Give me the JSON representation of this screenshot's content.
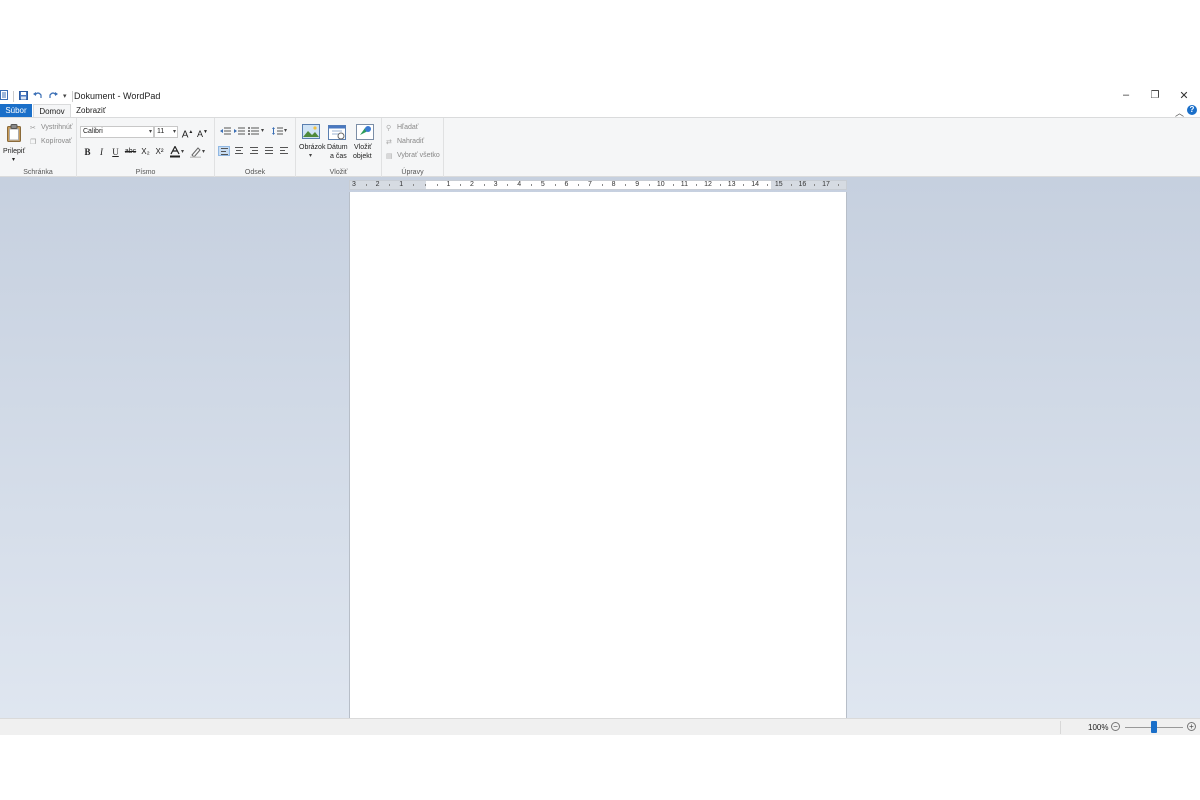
{
  "window": {
    "title": "Dokument - WordPad",
    "controls": {
      "minimize": "–",
      "restore": "❐",
      "close": "✕"
    }
  },
  "tabs": [
    {
      "label": "Súbor",
      "active": false
    },
    {
      "label": "Domov",
      "active": true
    },
    {
      "label": "Zobraziť",
      "active": false
    }
  ],
  "ribbon": {
    "clipboard": {
      "group_label": "Schránka",
      "paste": "Prilepiť",
      "cut": "Vystrihnúť",
      "copy": "Kopírovať"
    },
    "font": {
      "group_label": "Písmo",
      "family": "Calibri",
      "size": "11",
      "bold": "B",
      "italic": "I",
      "underline": "U",
      "strike": "abc",
      "subscript": "X₂",
      "superscript": "X²"
    },
    "paragraph": {
      "group_label": "Odsek"
    },
    "insert": {
      "group_label": "Vložiť",
      "picture_1": "Obrázok",
      "datetime_1": "Dátum",
      "datetime_2": "a čas",
      "object_1": "Vložiť",
      "object_2": "objekt"
    },
    "editing": {
      "group_label": "Úpravy",
      "find": "Hľadať",
      "replace": "Nahradiť",
      "select_all": "Vybrať všetko"
    }
  },
  "ruler": {
    "numbers": [
      "3",
      "2",
      "1",
      "1",
      "2",
      "3",
      "4",
      "5",
      "6",
      "7",
      "8",
      "9",
      "10",
      "11",
      "12",
      "13",
      "14",
      "15",
      "16",
      "17"
    ]
  },
  "status": {
    "zoom": "100%",
    "zoom_level": 0.5
  },
  "colors": {
    "accent": "#1a6fc9",
    "workspace_top": "#c6d0df",
    "workspace_bottom": "#dfe6f0"
  }
}
